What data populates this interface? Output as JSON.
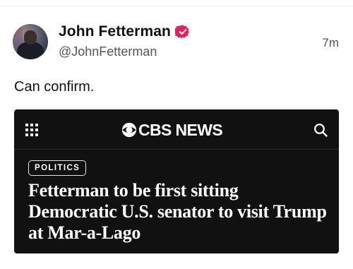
{
  "post": {
    "author": {
      "display_name": "John Fetterman",
      "handle": "@JohnFetterman",
      "verified": true,
      "verified_color": "#e0245e"
    },
    "timestamp": "7m",
    "text": "Can confirm."
  },
  "embed": {
    "source": "CBS NEWS",
    "category": "POLITICS",
    "headline": "Fetterman to be first sitting Democratic U.S. senator to visit Trump at Mar-a-Lago",
    "background_color": "#111111",
    "icons": {
      "menu": "grid-icon",
      "logo": "cbs-eye-logo",
      "search": "search-icon"
    }
  }
}
